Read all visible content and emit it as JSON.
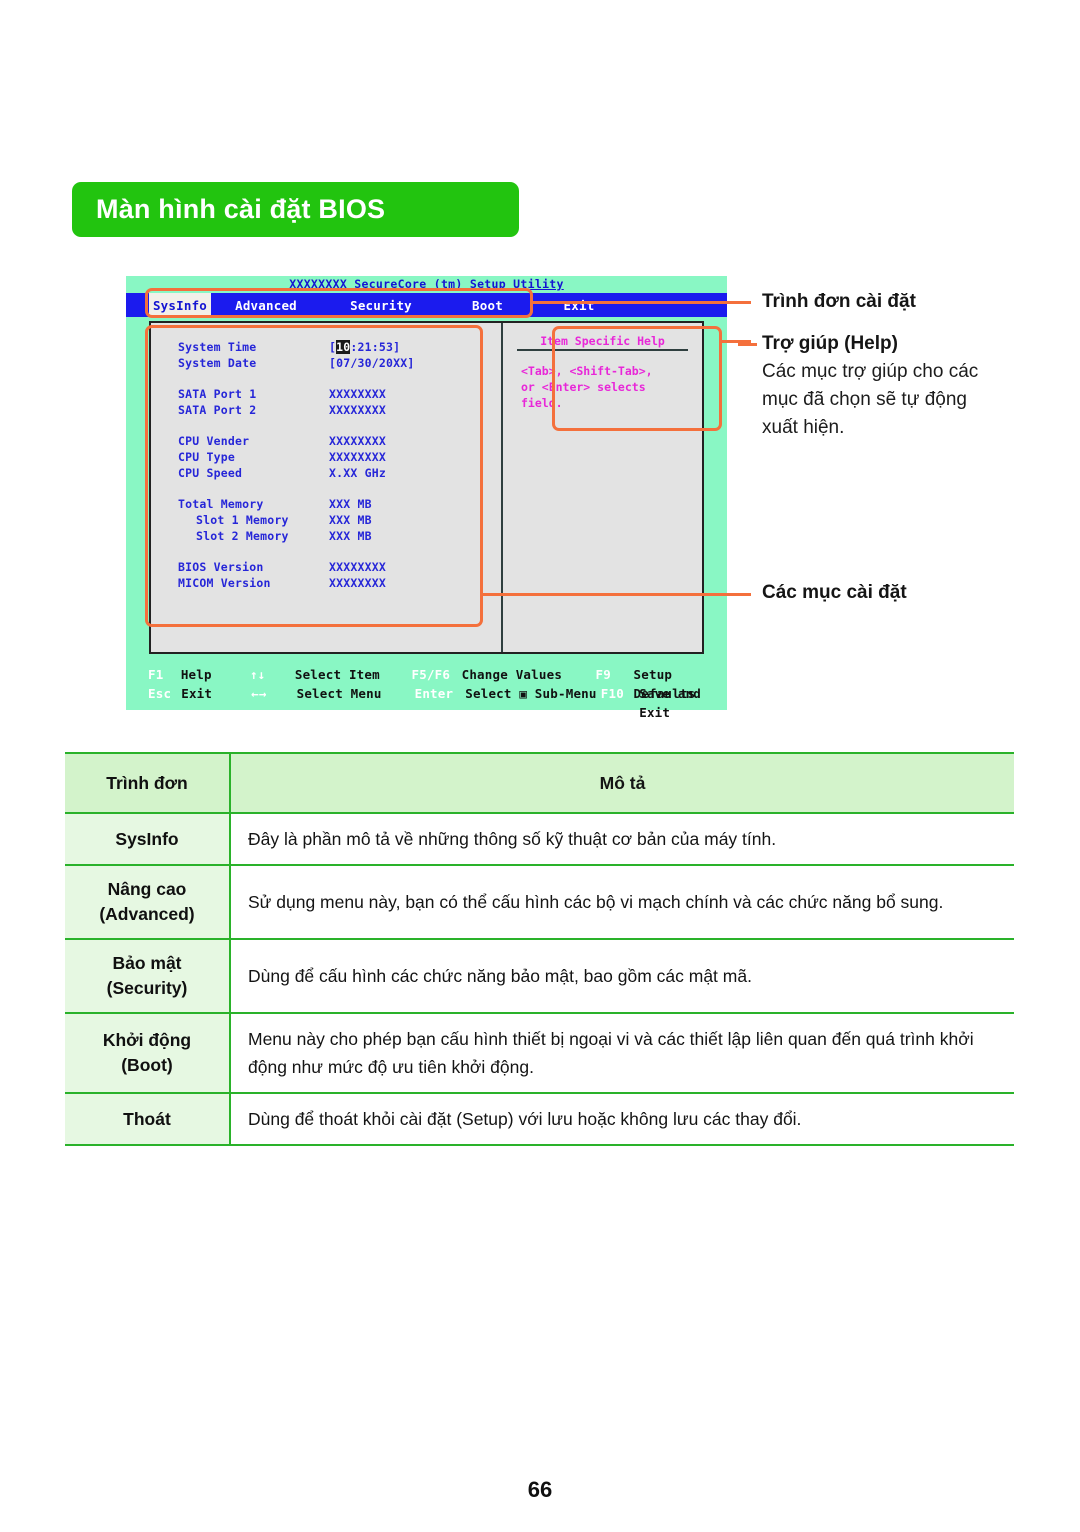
{
  "section": {
    "title": "Màn hình cài đặt BIOS",
    "banner_color": "#22c40f"
  },
  "bios": {
    "utility_title": "XXXXXXXX SecureCore (tm) Setup Utility",
    "menu": [
      {
        "label": "SysInfo",
        "active": true
      },
      {
        "label": "Advanced",
        "active": false
      },
      {
        "label": "Security",
        "active": false
      },
      {
        "label": "Boot",
        "active": false
      },
      {
        "label": "Exit",
        "active": false
      }
    ],
    "sysinfo": [
      {
        "label": "System Time",
        "value_prefix": "[",
        "value_hl": "10",
        "value_suffix": ":21:53]",
        "indent": false
      },
      {
        "label": "System Date",
        "value": "[07/30/20XX]",
        "indent": false
      },
      {
        "gap": true
      },
      {
        "label": "SATA Port 1",
        "value": "XXXXXXXX",
        "indent": false
      },
      {
        "label": "SATA Port 2",
        "value": "XXXXXXXX",
        "indent": false
      },
      {
        "gap": true
      },
      {
        "label": "CPU Vender",
        "value": "XXXXXXXX",
        "indent": false
      },
      {
        "label": "CPU Type",
        "value": "XXXXXXXX",
        "indent": false
      },
      {
        "label": "CPU Speed",
        "value": "X.XX GHz",
        "indent": false
      },
      {
        "gap": true
      },
      {
        "label": "Total Memory",
        "value": "XXX MB",
        "indent": false
      },
      {
        "label": "Slot 1 Memory",
        "value": "XXX MB",
        "indent": true
      },
      {
        "label": "Slot 2 Memory",
        "value": "XXX MB",
        "indent": true
      },
      {
        "gap": true
      },
      {
        "label": "BIOS Version",
        "value": "XXXXXXXX",
        "indent": false
      },
      {
        "label": "MICOM Version",
        "value": "XXXXXXXX",
        "indent": false
      }
    ],
    "help": {
      "heading": "Item Specific Help",
      "text": "<Tab>, <Shift-Tab>,\nor <Enter> selects\nfield."
    },
    "footer": [
      {
        "key": "F1",
        "desc": "Help",
        "key2": "↑↓",
        "desc2": "Select Item",
        "key3": "F5/F6",
        "desc3": "Change Values",
        "key4": "F9",
        "desc4": "Setup Defaults"
      },
      {
        "key": "Esc",
        "desc": "Exit",
        "key2": "←→",
        "desc2": "Select Menu",
        "key3": "Enter",
        "desc3": "Select ▣ Sub-Menu",
        "key4": "F10",
        "desc4": "Save and Exit"
      }
    ],
    "accent_color": "#f4703c",
    "screen_bg": "#89f7c4",
    "menubar_bg": "#1b1bee"
  },
  "callouts": [
    {
      "id": "menu",
      "heading": "Trình đơn cài đặt",
      "body": ""
    },
    {
      "id": "help",
      "heading": "Trợ giúp (Help)",
      "body": "Các mục trợ giúp cho các\nmục đã chọn sẽ tự động\nxuất hiện."
    },
    {
      "id": "items",
      "heading": "Các mục cài đặt",
      "body": ""
    }
  ],
  "table": {
    "headers": [
      "Trình đơn",
      "Mô tả"
    ],
    "rows": [
      {
        "menu": "SysInfo",
        "desc": "Đây là phần mô tả về những thông số kỹ thuật cơ bản của máy tính."
      },
      {
        "menu": "Nâng cao\n(Advanced)",
        "desc": "Sử dụng menu này, bạn có thể cấu hình các bộ vi mạch chính và các chức năng bổ sung."
      },
      {
        "menu": "Bảo mật\n(Security)",
        "desc": "Dùng để cấu hình các chức năng bảo mật, bao gồm các mật mã."
      },
      {
        "menu": "Khởi động\n(Boot)",
        "desc": "Menu này cho phép bạn cấu hình thiết bị ngoại vi và các thiết lập liên quan đến quá trình khởi động như mức độ ưu tiên khởi động."
      },
      {
        "menu": "Thoát",
        "desc": "Dùng để thoát khỏi cài đặt (Setup) với lưu hoặc không lưu các thay đổi."
      }
    ]
  },
  "page": {
    "number": "66"
  }
}
